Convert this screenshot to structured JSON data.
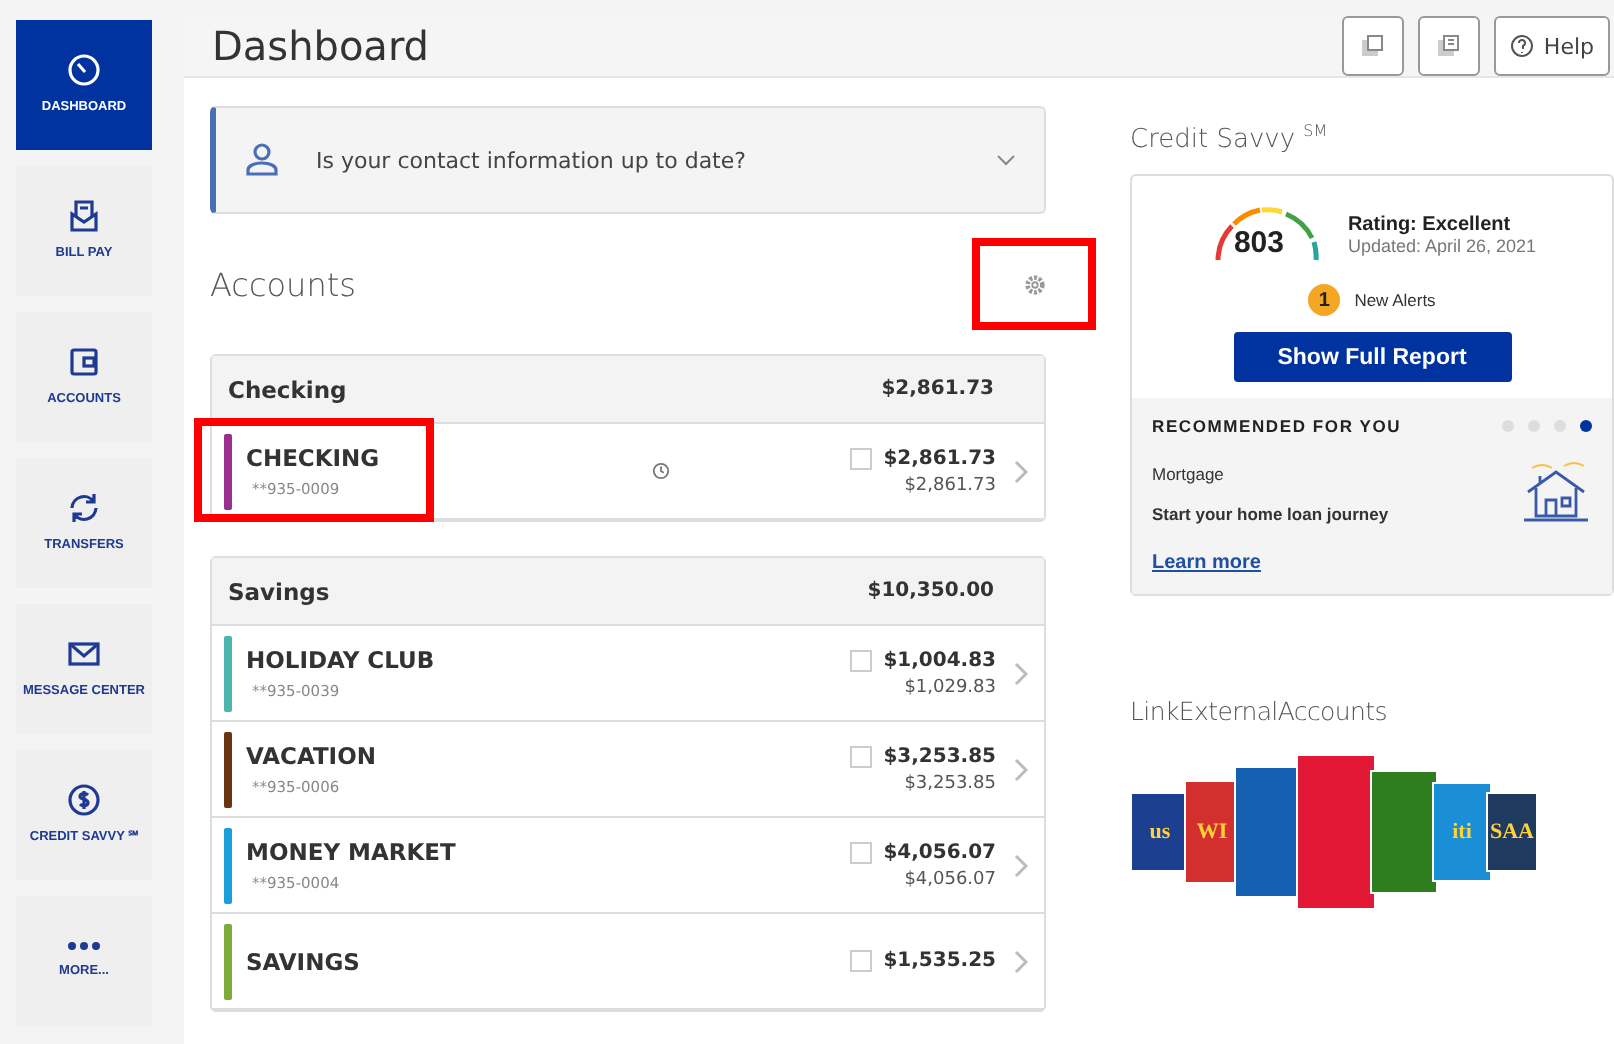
{
  "sidebar": {
    "items": [
      {
        "label": "DASHBOARD",
        "selected": true
      },
      {
        "label": "BILL PAY",
        "selected": false
      },
      {
        "label": "ACCOUNTS",
        "selected": false
      },
      {
        "label": "TRANSFERS",
        "selected": false
      },
      {
        "label": "MESSAGE CENTER",
        "selected": false
      },
      {
        "label": "CREDIT SAVVY ℠",
        "selected": false
      },
      {
        "label": "MORE...",
        "selected": false
      }
    ]
  },
  "header": {
    "title": "Dashboard",
    "buttons": [
      {
        "kind": "print"
      },
      {
        "kind": "export"
      },
      {
        "kind": "help",
        "label": "Help"
      }
    ]
  },
  "contact_banner": {
    "text": "Is your contact information up to date?",
    "expanded": false
  },
  "accounts": {
    "title": "Accounts",
    "settings_highlighted": true,
    "groups": [
      {
        "name": "Checking",
        "total": "$2,861.73",
        "items": [
          {
            "name": "CHECKING",
            "number": "**935-0009",
            "color": "#9b2f8f",
            "pending": true,
            "available": "$2,861.73",
            "current": "$2,861.73",
            "highlighted": true
          }
        ]
      },
      {
        "name": "Savings",
        "total": "$10,350.00",
        "items": [
          {
            "name": "HOLIDAY CLUB",
            "number": "**935-0039",
            "color": "#4db6ac",
            "pending": false,
            "available": "$1,004.83",
            "current": "$1,029.83",
            "highlighted": false
          },
          {
            "name": "VACATION",
            "number": "**935-0006",
            "color": "#6b3410",
            "pending": false,
            "available": "$3,253.85",
            "current": "$3,253.85",
            "highlighted": false
          },
          {
            "name": "MONEY MARKET",
            "number": "**935-0004",
            "color": "#1a9fd8",
            "pending": false,
            "available": "$4,056.07",
            "current": "$4,056.07",
            "highlighted": false
          },
          {
            "name": "SAVINGS",
            "color": "#7cab3a",
            "pending": false,
            "available": "$1,535.25",
            "highlighted": false
          }
        ]
      }
    ]
  },
  "credit_savvy": {
    "title": "Credit Savvy ",
    "title_mark": "SM",
    "score": "803",
    "rating": "Rating: Excellent",
    "updated": "Updated: April 26, 2021",
    "alert_count": "1",
    "alerts_label": "New Alerts",
    "button": "Show Full Report",
    "recommended": {
      "heading": "RECOMMENDED FOR YOU",
      "dots": [
        {
          "selected": false
        },
        {
          "selected": false
        },
        {
          "selected": false
        },
        {
          "selected": true
        }
      ],
      "product": "Mortgage",
      "text": "Start your home loan journey",
      "link": "Learn more"
    }
  },
  "link_external": {
    "title": "LinkExternalAccounts",
    "logos": [
      {
        "label": "us",
        "color": "#1d3f8f"
      },
      {
        "label": "WI",
        "color": "#d32f2f"
      },
      {
        "color": "#1560b0"
      },
      {
        "color": "#e31837"
      },
      {
        "color": "#2e7d1f"
      },
      {
        "label": "iti",
        "color": "#1a8fd8"
      },
      {
        "label": "SAA",
        "color": "#1f3a5f"
      }
    ]
  }
}
